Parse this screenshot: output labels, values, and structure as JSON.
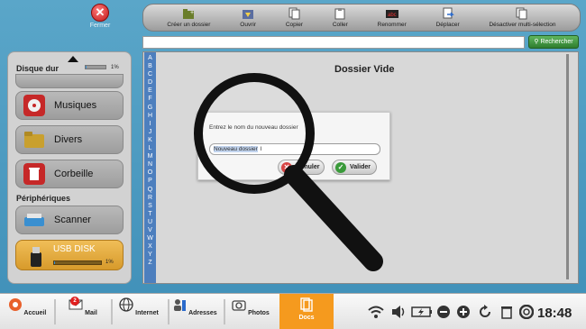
{
  "top": {
    "close_label": "Fermer"
  },
  "toolbar": {
    "buttons": [
      {
        "label": "Créer un dossier",
        "icon": "new-folder-icon"
      },
      {
        "label": "Ouvrir",
        "icon": "open-icon"
      },
      {
        "label": "Copier",
        "icon": "copy-icon"
      },
      {
        "label": "Coller",
        "icon": "paste-icon"
      },
      {
        "label": "Renommer",
        "icon": "rename-icon"
      },
      {
        "label": "Déplacer",
        "icon": "move-icon"
      },
      {
        "label": "Désactiver multi-sélection",
        "icon": "multi-select-icon"
      }
    ]
  },
  "search": {
    "button_label": "Rechercher",
    "value": ""
  },
  "sidebar": {
    "disk_title": "Disque dur",
    "disk_usage_percent": "1%",
    "disk_usage_fraction": 0.01,
    "items": [
      {
        "label": "Musiques",
        "icon": "music-icon"
      },
      {
        "label": "Divers",
        "icon": "folder-icon"
      },
      {
        "label": "Corbeille",
        "icon": "trash-icon"
      }
    ],
    "devices_title": "Périphériques",
    "devices": [
      {
        "label": "Scanner",
        "icon": "scanner-icon"
      }
    ],
    "usb": {
      "label": "USB DISK",
      "usage_percent": "1%",
      "usage_fraction": 0.01
    }
  },
  "main": {
    "alphabet": [
      "A",
      "B",
      "C",
      "D",
      "E",
      "F",
      "G",
      "H",
      "I",
      "J",
      "K",
      "L",
      "M",
      "N",
      "O",
      "P",
      "Q",
      "R",
      "S",
      "T",
      "U",
      "V",
      "W",
      "X",
      "Y",
      "Z"
    ],
    "empty_title": "Dossier Vide"
  },
  "dialog": {
    "prompt": "Entrez le nom du nouveau dossier",
    "input_value": "Nouveau dossier",
    "cancel_label": "Annuler",
    "confirm_label": "Valider"
  },
  "bottom": {
    "items": [
      {
        "label": "Accueil",
        "icon": "home-icon"
      },
      {
        "label": "Mail",
        "icon": "mail-icon",
        "badge": "2"
      },
      {
        "label": "Internet",
        "icon": "globe-icon"
      },
      {
        "label": "Adresses",
        "icon": "contacts-icon"
      },
      {
        "label": "Photos",
        "icon": "camera-icon"
      },
      {
        "label": "Docs",
        "icon": "docs-icon"
      }
    ],
    "clock": "18:48"
  },
  "colors": {
    "background": "#4a9cc4",
    "docs_active": "#f59a1e",
    "usb_item": "#e3a83f",
    "alphabet_bar": "#4d7fbe",
    "search_button": "#3e963e"
  }
}
